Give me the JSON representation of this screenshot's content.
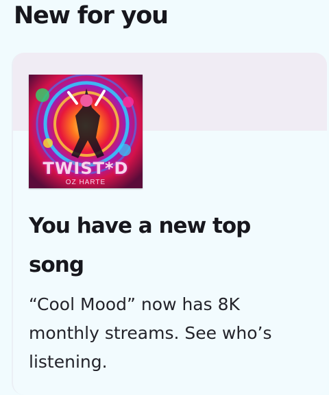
{
  "section": {
    "title": "New for you"
  },
  "card": {
    "cover": {
      "title": "TWIST*D",
      "artist": "OZ HARTE"
    },
    "heading": "You have a new top song",
    "body": "“Cool Mood” now has 8K monthly streams. See who’s listening."
  }
}
